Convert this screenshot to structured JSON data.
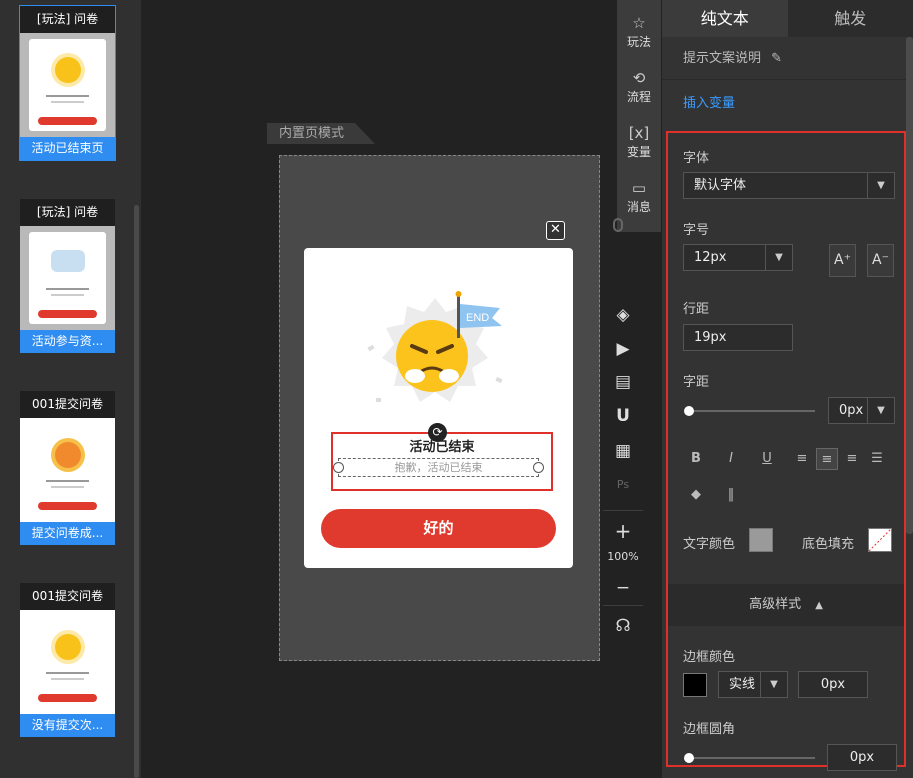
{
  "thumbnails": [
    {
      "title": "[玩法] 问卷",
      "footer": "活动已结束页",
      "selected": true
    },
    {
      "title": "[玩法] 问卷",
      "footer": "活动参与资..."
    },
    {
      "title": "001提交问卷",
      "footer": "提交问卷成..."
    },
    {
      "title": "001提交问卷",
      "footer": "没有提交次..."
    }
  ],
  "canvas": {
    "mode_tab": "内置页模式",
    "close_glyph": "✕",
    "flag_text": "END",
    "title": "活动已结束",
    "subtitle": "抱歉，活动已结束",
    "button": "好的"
  },
  "top_tools": [
    {
      "icon": "game-icon",
      "glyph": "☆",
      "label": "玩法"
    },
    {
      "icon": "flow-icon",
      "glyph": "⟲",
      "label": "流程"
    },
    {
      "icon": "variable-icon",
      "glyph": "[x]",
      "label": "变量"
    },
    {
      "icon": "message-icon",
      "glyph": "▭",
      "label": "消息"
    }
  ],
  "side_tools": {
    "zoom": "100%",
    "zoom_in": "+",
    "zoom_out": "−"
  },
  "panel": {
    "tabs": [
      "纯文本",
      "触发"
    ],
    "hint": "提示文案说明",
    "insert_variable": "插入变量",
    "font_label": "字体",
    "font_value": "默认字体",
    "size_label": "字号",
    "size_value": "12px",
    "increase_font": "A⁺",
    "decrease_font": "A⁻",
    "line_height_label": "行距",
    "line_height_value": "19px",
    "letter_spacing_label": "字距",
    "letter_spacing_value": "0px",
    "letter_spacing_level": 0,
    "format_buttons": [
      "B",
      "I",
      "U"
    ],
    "text_color_label": "文字颜色",
    "text_color": "#9a9a9a",
    "bg_fill_label": "底色填充",
    "advanced_label": "高级样式",
    "border_color_label": "边框颜色",
    "border_color": "#000000",
    "border_style": "实线",
    "border_width": "0px",
    "border_radius_label": "边框圆角",
    "border_radius_value": "0px",
    "border_radius_level": 0
  }
}
